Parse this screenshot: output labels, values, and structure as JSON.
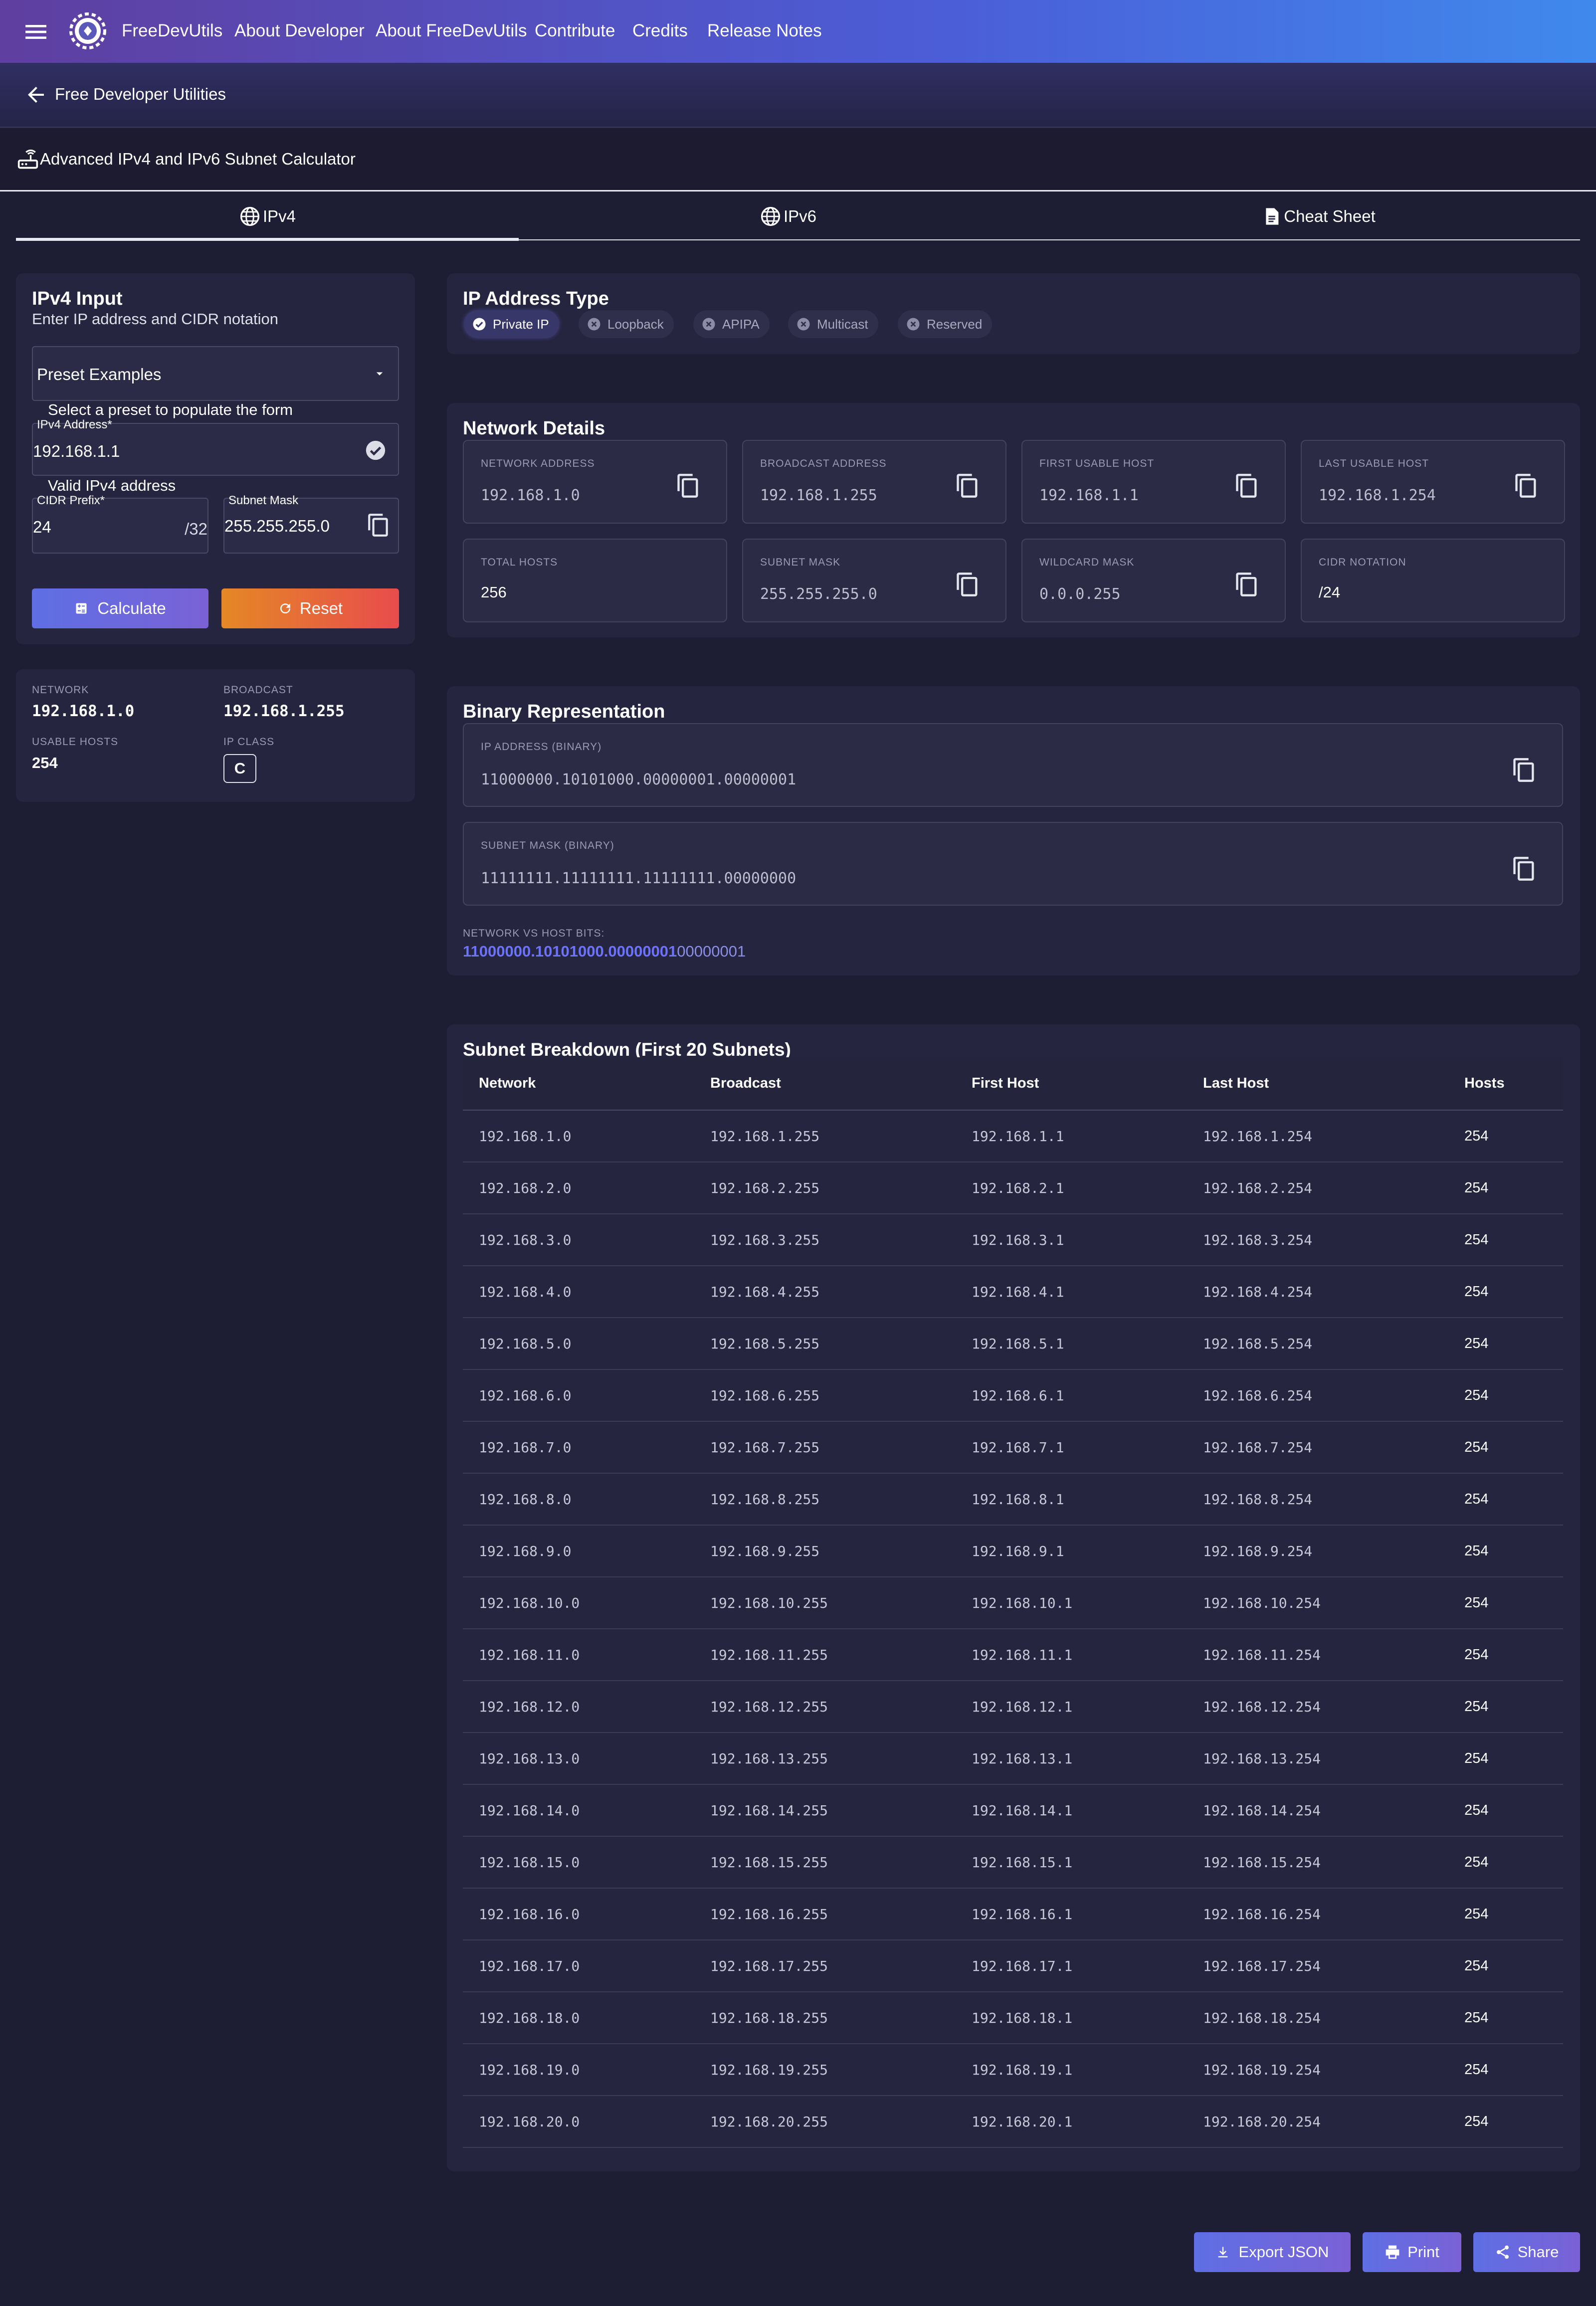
{
  "header": {
    "brand": "FreeDevUtils",
    "nav": [
      "About Developer",
      "About FreeDevUtils",
      "Contribute",
      "Credits",
      "Release Notes"
    ]
  },
  "subheader": {
    "back_label": "Free Developer Utilities"
  },
  "page": {
    "title": "Advanced IPv4 and IPv6 Subnet Calculator"
  },
  "tabs": [
    {
      "label": "IPv4",
      "icon": "globe-icon",
      "active": true
    },
    {
      "label": "IPv6",
      "icon": "globe-icon",
      "active": false
    },
    {
      "label": "Cheat Sheet",
      "icon": "document-icon",
      "active": false
    }
  ],
  "input_card": {
    "title": "IPv4 Input",
    "subtitle": "Enter IP address and CIDR notation",
    "preset": {
      "value": "Preset Examples",
      "helper": "Select a preset to populate the form"
    },
    "ip_field": {
      "label": "IPv4 Address*",
      "value": "192.168.1.1",
      "helper": "Valid IPv4 address"
    },
    "cidr_field": {
      "label": "CIDR Prefix*",
      "value": "24",
      "suffix": "/32"
    },
    "mask_field": {
      "label": "Subnet Mask",
      "value": "255.255.255.0"
    },
    "calculate_label": "Calculate",
    "reset_label": "Reset"
  },
  "summary": {
    "network_label": "Network",
    "network": "192.168.1.0",
    "broadcast_label": "Broadcast",
    "broadcast": "192.168.1.255",
    "usable_label": "Usable Hosts",
    "usable": "254",
    "class_label": "IP Class",
    "ip_class": "C"
  },
  "ip_type": {
    "title": "IP Address Type",
    "chips": [
      {
        "label": "Private IP",
        "active": true
      },
      {
        "label": "Loopback",
        "active": false
      },
      {
        "label": "APIPA",
        "active": false
      },
      {
        "label": "Multicast",
        "active": false
      },
      {
        "label": "Reserved",
        "active": false
      }
    ]
  },
  "network_details": {
    "title": "Network Details",
    "items": [
      {
        "label": "Network Address",
        "value": "192.168.1.0"
      },
      {
        "label": "Broadcast Address",
        "value": "192.168.1.255"
      },
      {
        "label": "First Usable Host",
        "value": "192.168.1.1"
      },
      {
        "label": "Last Usable Host",
        "value": "192.168.1.254"
      },
      {
        "label": "Total Hosts",
        "value": "256"
      },
      {
        "label": "Subnet Mask",
        "value": "255.255.255.0"
      },
      {
        "label": "Wildcard Mask",
        "value": "0.0.0.255"
      },
      {
        "label": "CIDR Notation",
        "value": "/24"
      }
    ]
  },
  "binary": {
    "title": "Binary Representation",
    "ip_label": "IP Address (Binary)",
    "ip_value": "11000000.10101000.00000001.00000001",
    "mask_label": "Subnet Mask (Binary)",
    "mask_value": "11111111.11111111.11111111.00000000",
    "bits_label": "Network vs Host Bits:",
    "network_bits": "11000000.10101000.00000001",
    "host_bits": "00000001"
  },
  "breakdown": {
    "title": "Subnet Breakdown (First 20 Subnets)",
    "columns": [
      "Network",
      "Broadcast",
      "First Host",
      "Last Host",
      "Hosts"
    ],
    "rows": [
      [
        "192.168.1.0",
        "192.168.1.255",
        "192.168.1.1",
        "192.168.1.254",
        "254"
      ],
      [
        "192.168.2.0",
        "192.168.2.255",
        "192.168.2.1",
        "192.168.2.254",
        "254"
      ],
      [
        "192.168.3.0",
        "192.168.3.255",
        "192.168.3.1",
        "192.168.3.254",
        "254"
      ],
      [
        "192.168.4.0",
        "192.168.4.255",
        "192.168.4.1",
        "192.168.4.254",
        "254"
      ],
      [
        "192.168.5.0",
        "192.168.5.255",
        "192.168.5.1",
        "192.168.5.254",
        "254"
      ],
      [
        "192.168.6.0",
        "192.168.6.255",
        "192.168.6.1",
        "192.168.6.254",
        "254"
      ],
      [
        "192.168.7.0",
        "192.168.7.255",
        "192.168.7.1",
        "192.168.7.254",
        "254"
      ],
      [
        "192.168.8.0",
        "192.168.8.255",
        "192.168.8.1",
        "192.168.8.254",
        "254"
      ],
      [
        "192.168.9.0",
        "192.168.9.255",
        "192.168.9.1",
        "192.168.9.254",
        "254"
      ],
      [
        "192.168.10.0",
        "192.168.10.255",
        "192.168.10.1",
        "192.168.10.254",
        "254"
      ],
      [
        "192.168.11.0",
        "192.168.11.255",
        "192.168.11.1",
        "192.168.11.254",
        "254"
      ],
      [
        "192.168.12.0",
        "192.168.12.255",
        "192.168.12.1",
        "192.168.12.254",
        "254"
      ],
      [
        "192.168.13.0",
        "192.168.13.255",
        "192.168.13.1",
        "192.168.13.254",
        "254"
      ],
      [
        "192.168.14.0",
        "192.168.14.255",
        "192.168.14.1",
        "192.168.14.254",
        "254"
      ],
      [
        "192.168.15.0",
        "192.168.15.255",
        "192.168.15.1",
        "192.168.15.254",
        "254"
      ],
      [
        "192.168.16.0",
        "192.168.16.255",
        "192.168.16.1",
        "192.168.16.254",
        "254"
      ],
      [
        "192.168.17.0",
        "192.168.17.255",
        "192.168.17.1",
        "192.168.17.254",
        "254"
      ],
      [
        "192.168.18.0",
        "192.168.18.255",
        "192.168.18.1",
        "192.168.18.254",
        "254"
      ],
      [
        "192.168.19.0",
        "192.168.19.255",
        "192.168.19.1",
        "192.168.19.254",
        "254"
      ],
      [
        "192.168.20.0",
        "192.168.20.255",
        "192.168.20.1",
        "192.168.20.254",
        "254"
      ]
    ]
  },
  "actions": {
    "export_label": "Export JSON",
    "print_label": "Print",
    "share_label": "Share"
  },
  "colors": {
    "accent_blue": "#5b6ee1",
    "calculate_button": "#6f6ee0",
    "reset_button_start": "#e48826",
    "reset_button_end": "#e84c4c",
    "network_bits": "#6b73ff"
  }
}
